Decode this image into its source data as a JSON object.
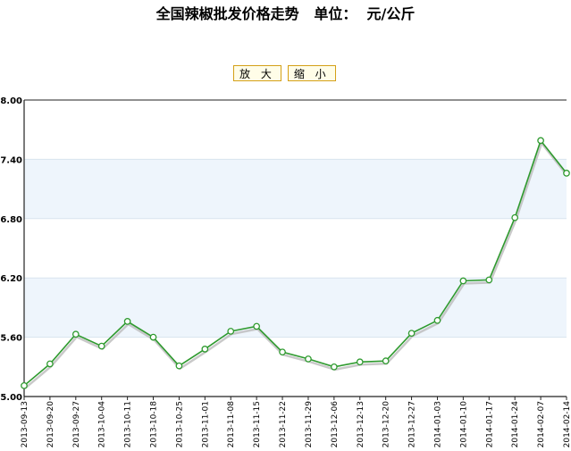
{
  "title": {
    "main": "全国辣椒批发价格走势",
    "unit_label": "单位：",
    "unit": "元/公斤"
  },
  "controls": {
    "zoom_in_label": "放 大",
    "zoom_out_label": "缩 小"
  },
  "colors": {
    "line": "#2e9a2e",
    "shadow": "#bbbbbb",
    "band": "#eef5fc",
    "grid": "#d8e4ef",
    "axis": "#222222"
  },
  "chart_data": {
    "type": "line",
    "title": "全国辣椒批发价格走势",
    "ylim": [
      5.0,
      8.0
    ],
    "y_ticks": [
      "5.00",
      "5.60",
      "6.20",
      "6.80",
      "7.40",
      "8.00"
    ],
    "grid": true,
    "x": [
      "2013-09-13",
      "2013-09-20",
      "2013-09-27",
      "2013-10-04",
      "2013-10-11",
      "2013-10-18",
      "2013-10-25",
      "2013-11-01",
      "2013-11-08",
      "2013-11-15",
      "2013-11-22",
      "2013-11-29",
      "2013-12-06",
      "2013-12-13",
      "2013-12-20",
      "2013-12-27",
      "2014-01-03",
      "2014-01-10",
      "2014-01-17",
      "2014-01-24",
      "2014-02-07",
      "2014-02-14"
    ],
    "series": [
      {
        "values": [
          5.11,
          5.33,
          5.63,
          5.51,
          5.76,
          5.6,
          5.31,
          5.48,
          5.66,
          5.71,
          5.45,
          5.38,
          5.3,
          5.35,
          5.36,
          5.64,
          5.77,
          6.17,
          6.18,
          6.81,
          7.59,
          7.26
        ]
      }
    ]
  }
}
